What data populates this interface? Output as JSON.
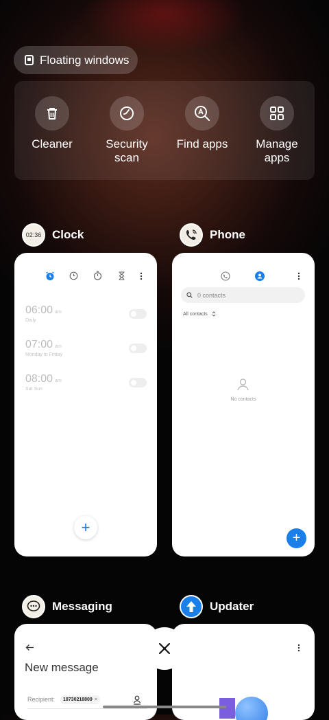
{
  "floating_windows": {
    "label": "Floating windows"
  },
  "tools": [
    {
      "label": "Cleaner",
      "icon": "trash-icon"
    },
    {
      "label": "Security\nscan",
      "icon": "shield-check-icon"
    },
    {
      "label": "Find apps",
      "icon": "search-apps-icon"
    },
    {
      "label": "Manage\napps",
      "icon": "grid-icon"
    }
  ],
  "clock": {
    "name": "Clock",
    "icon_text": "02:36",
    "alarms": [
      {
        "time": "06:00",
        "ampm": "am",
        "days": "Daily"
      },
      {
        "time": "07:00",
        "ampm": "am",
        "days": "Monday to Friday"
      },
      {
        "time": "08:00",
        "ampm": "am",
        "days": "Sat Sun"
      }
    ],
    "add": "+"
  },
  "phone": {
    "name": "Phone",
    "search_placeholder": "0 contacts",
    "filter": "All contacts",
    "empty": "No contacts",
    "add": "+"
  },
  "messaging": {
    "name": "Messaging",
    "title": "New message",
    "recipient_label": "Recipient:",
    "recipient": "18730218809",
    "recipient_remove": "×"
  },
  "updater": {
    "name": "Updater"
  },
  "colors": {
    "accent": "#1a7fe8",
    "card": "#ffffff"
  }
}
